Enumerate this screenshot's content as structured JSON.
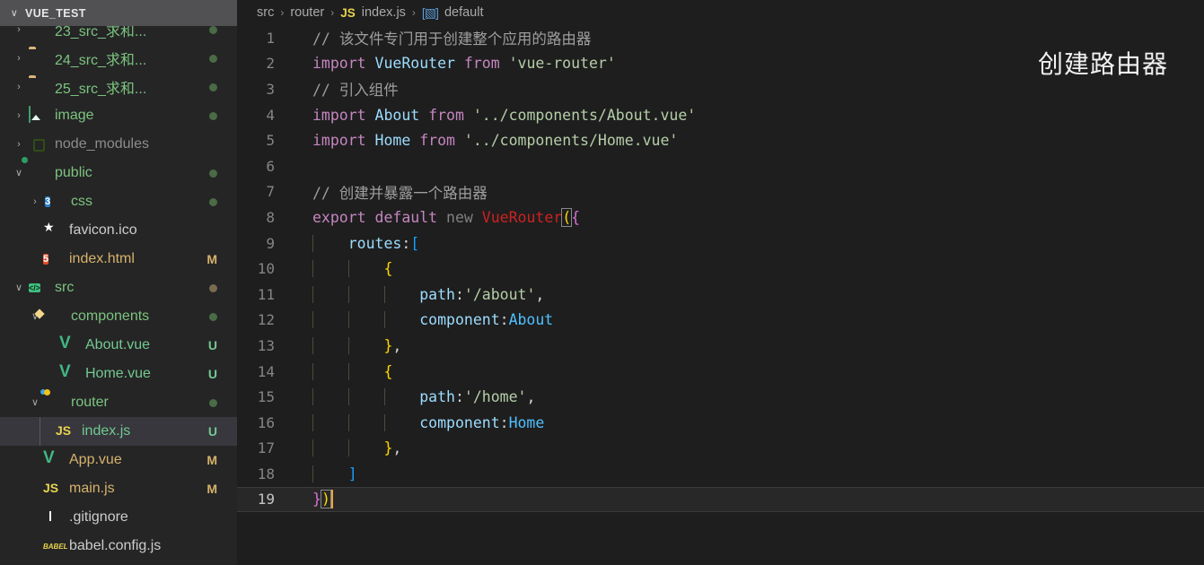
{
  "sidebar": {
    "title": "VUE_TEST",
    "title_chevron": "∨",
    "items": [
      {
        "label": "23_src_求和...",
        "icon": "folder-icon",
        "twisty": "›",
        "indent": 0,
        "badge": "",
        "dot": "green",
        "color": "green",
        "partial": true
      },
      {
        "label": "24_src_求和...",
        "icon": "folder-icon",
        "twisty": "›",
        "indent": 0,
        "badge": "",
        "dot": "green",
        "color": "green"
      },
      {
        "label": "25_src_求和...",
        "icon": "folder-icon",
        "twisty": "›",
        "indent": 0,
        "badge": "",
        "dot": "green",
        "color": "green"
      },
      {
        "label": "image",
        "icon": "image-folder-icon",
        "twisty": "›",
        "indent": 0,
        "badge": "",
        "dot": "green",
        "color": "green"
      },
      {
        "label": "node_modules",
        "icon": "node-folder-icon",
        "twisty": "›",
        "indent": 0,
        "badge": "",
        "dot": "",
        "color": "grey"
      },
      {
        "label": "public",
        "icon": "public-folder-icon",
        "twisty": "∨",
        "indent": 0,
        "badge": "",
        "dot": "green",
        "color": "green"
      },
      {
        "label": "css",
        "icon": "css-folder-icon",
        "twisty": "›",
        "indent": 1,
        "badge": "",
        "dot": "green",
        "color": "green"
      },
      {
        "label": "favicon.ico",
        "icon": "favicon-icon",
        "twisty": "",
        "indent": 1,
        "badge": "",
        "dot": "",
        "color": "white"
      },
      {
        "label": "index.html",
        "icon": "html-icon",
        "twisty": "",
        "indent": 1,
        "badge": "M",
        "dot": "",
        "color": "mod"
      },
      {
        "label": "src",
        "icon": "src-folder-icon",
        "twisty": "∨",
        "indent": 0,
        "badge": "",
        "dot": "brown",
        "color": "green"
      },
      {
        "label": "components",
        "icon": "components-folder-icon",
        "twisty": "∨",
        "indent": 1,
        "badge": "",
        "dot": "green",
        "color": "green"
      },
      {
        "label": "About.vue",
        "icon": "vue-icon",
        "twisty": "",
        "indent": 2,
        "badge": "U",
        "dot": "",
        "color": "untracked"
      },
      {
        "label": "Home.vue",
        "icon": "vue-icon",
        "twisty": "",
        "indent": 2,
        "badge": "U",
        "dot": "",
        "color": "untracked"
      },
      {
        "label": "router",
        "icon": "router-folder-icon",
        "twisty": "∨",
        "indent": 1,
        "badge": "",
        "dot": "green",
        "color": "green"
      },
      {
        "label": "index.js",
        "icon": "js-icon",
        "twisty": "",
        "indent": 2,
        "badge": "U",
        "dot": "",
        "color": "untracked",
        "selected": true
      },
      {
        "label": "App.vue",
        "icon": "vue-icon",
        "twisty": "",
        "indent": 1,
        "badge": "M",
        "dot": "",
        "color": "mod"
      },
      {
        "label": "main.js",
        "icon": "js-icon",
        "twisty": "",
        "indent": 1,
        "badge": "M",
        "dot": "",
        "color": "mod"
      },
      {
        "label": ".gitignore",
        "icon": "git-icon",
        "twisty": "",
        "indent": 1,
        "badge": "",
        "dot": "",
        "color": "white"
      },
      {
        "label": "babel.config.js",
        "icon": "babel-icon",
        "twisty": "",
        "indent": 1,
        "badge": "",
        "dot": "",
        "color": "white"
      }
    ]
  },
  "breadcrumb": {
    "parts": [
      "src",
      "router",
      "index.js",
      "default"
    ],
    "separator": "›",
    "file_icon_label": "JS",
    "symbol_icon_label": "[▧]"
  },
  "editor": {
    "filename": "index.js",
    "current_line": 19,
    "lines": [
      {
        "n": 1,
        "text": "// 该文件专门用于创建整个应用的路由器"
      },
      {
        "n": 2,
        "text": "import VueRouter from 'vue-router'"
      },
      {
        "n": 3,
        "text": "// 引入组件"
      },
      {
        "n": 4,
        "text": "import About from '../components/About.vue'"
      },
      {
        "n": 5,
        "text": "import Home from '../components/Home.vue'"
      },
      {
        "n": 6,
        "text": ""
      },
      {
        "n": 7,
        "text": "// 创建并暴露一个路由器"
      },
      {
        "n": 8,
        "text": "export default new VueRouter({"
      },
      {
        "n": 9,
        "text": "    routes:["
      },
      {
        "n": 10,
        "text": "        {"
      },
      {
        "n": 11,
        "text": "            path:'/about',"
      },
      {
        "n": 12,
        "text": "            component:About"
      },
      {
        "n": 13,
        "text": "        },"
      },
      {
        "n": 14,
        "text": "        {"
      },
      {
        "n": 15,
        "text": "            path:'/home',"
      },
      {
        "n": 16,
        "text": "            component:Home"
      },
      {
        "n": 17,
        "text": "        },"
      },
      {
        "n": 18,
        "text": "    ]"
      },
      {
        "n": 19,
        "text": "})"
      }
    ]
  },
  "annotation": {
    "text": "创建路由器"
  },
  "colors": {
    "background": "#1e1e1e",
    "sidebar_background": "#252526",
    "title_background": "#515153",
    "selection": "#37373d",
    "comment": "#6a9955",
    "keyword": "#c586c0",
    "identifier": "#9cdcfe",
    "string": "#ce9178",
    "error": "#cc2222",
    "bracket1": "#ffd700",
    "bracket2": "#da70d6",
    "bracket3": "#179fff",
    "cursor": "#e8a33d",
    "untracked": "#73c991",
    "modified": "#d6b26b"
  }
}
